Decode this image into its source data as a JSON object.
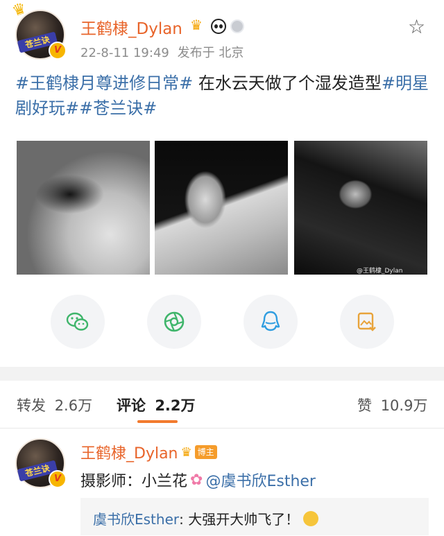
{
  "post": {
    "username": "王鹤棣_Dylan",
    "datetime": "22-8-11 19:49",
    "published_from": "发布于 北京",
    "avatar_banner": "苍兰诀",
    "verified_mark": "V",
    "text_tag1": "#王鹤棣月尊进修日常#",
    "text_body": " 在水云天做了个湿发造型",
    "text_tag2": "#明星剧好玩#",
    "text_tag3": "#苍兰诀#",
    "watermark": "@王鹤棣_Dylan",
    "icons": [
      "wechat-icon",
      "moments-icon",
      "qq-icon",
      "save-image-icon"
    ]
  },
  "stats": {
    "repost_label": "转发",
    "repost_count": "2.6万",
    "comment_label": "评论",
    "comment_count": "2.2万",
    "like_label": "赞",
    "like_count": "10.9万"
  },
  "comment": {
    "username": "王鹤棣_Dylan",
    "owner_badge": "博主",
    "text": "摄影师：小兰花",
    "mention": "@虞书欣Esther",
    "reply_author": "虞书欣Esther",
    "reply_text": ": 大强开大帅飞了！"
  },
  "colors": {
    "accent_orange": "#e8642a",
    "link_blue": "#3b6fa8",
    "tab_underline": "#f27a2e"
  }
}
